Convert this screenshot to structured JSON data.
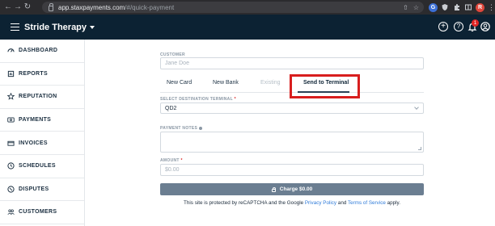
{
  "browser": {
    "url_host": "app.staxpayments.com",
    "url_path": "/#/quick-payment",
    "profile_initial": "R",
    "ext_initial": "G"
  },
  "header": {
    "brand": "Stride Therapy",
    "notification_count": "1"
  },
  "sidebar": {
    "items": [
      {
        "label": "DASHBOARD",
        "icon": "dashboard-icon"
      },
      {
        "label": "REPORTS",
        "icon": "reports-icon"
      },
      {
        "label": "REPUTATION",
        "icon": "star-icon"
      },
      {
        "label": "PAYMENTS",
        "icon": "payments-icon"
      },
      {
        "label": "INVOICES",
        "icon": "invoices-icon"
      },
      {
        "label": "SCHEDULES",
        "icon": "clock-icon"
      },
      {
        "label": "DISPUTES",
        "icon": "disputes-icon"
      },
      {
        "label": "CUSTOMERS",
        "icon": "customers-icon"
      }
    ]
  },
  "form": {
    "customer_label": "CUSTOMER",
    "customer_placeholder": "Jane Doe",
    "tabs": [
      {
        "label": "New Card",
        "state": "normal"
      },
      {
        "label": "New Bank",
        "state": "normal"
      },
      {
        "label": "Existing",
        "state": "disabled"
      },
      {
        "label": "Send to Terminal",
        "state": "active"
      }
    ],
    "terminal_label": "SELECT DESTINATION TERMINAL",
    "required_mark": "*",
    "terminal_value": "QD2",
    "notes_label": "PAYMENT NOTES",
    "amount_label": "AMOUNT",
    "amount_placeholder": "$0.00",
    "charge_label": "Charge $0.00",
    "recaptcha": {
      "prefix": "This site is protected by reCAPTCHA and the Google ",
      "privacy": "Privacy Policy",
      "and": " and ",
      "terms": "Terms of Service",
      "suffix": " apply."
    }
  },
  "colors": {
    "header_bg": "#0c2233",
    "highlight_red": "#d81e1e",
    "charge_btn": "#6b7e91",
    "link": "#2f7bd9"
  }
}
